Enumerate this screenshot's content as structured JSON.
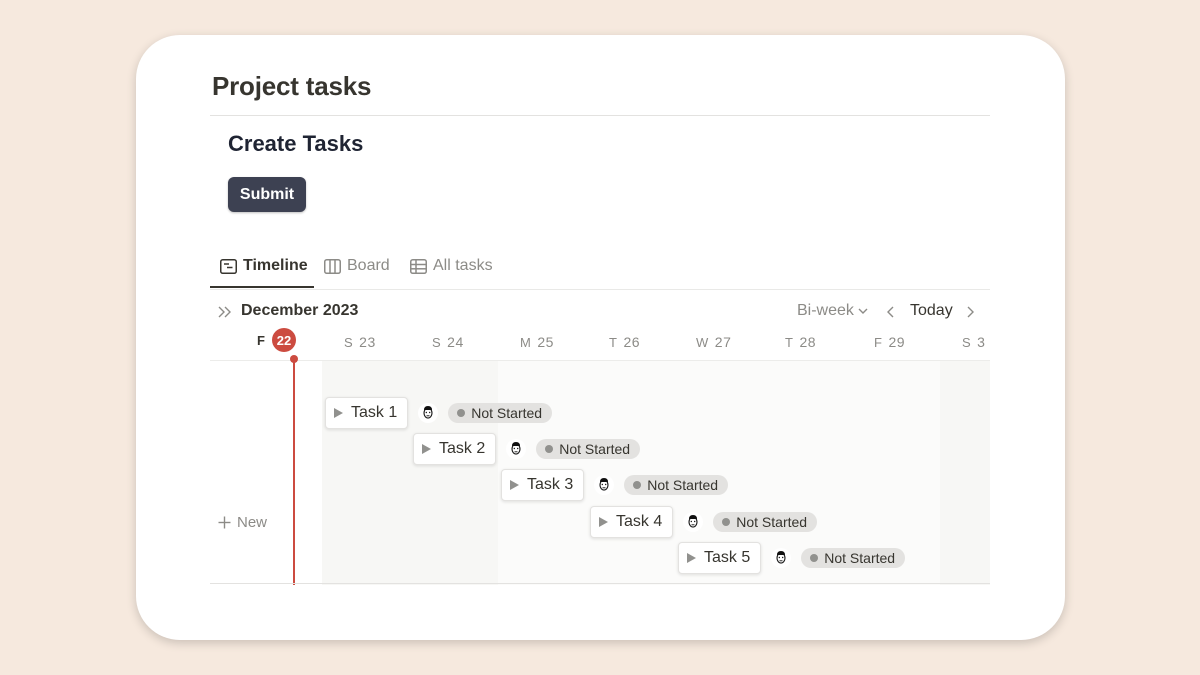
{
  "page": {
    "title": "Project tasks"
  },
  "form": {
    "title": "Create Tasks",
    "submit_label": "Submit"
  },
  "tabs": [
    {
      "label": "Timeline",
      "icon": "timeline-icon",
      "active": true
    },
    {
      "label": "Board",
      "icon": "board-icon",
      "active": false
    },
    {
      "label": "All tasks",
      "icon": "table-icon",
      "active": false
    }
  ],
  "timeline": {
    "month": "December 2023",
    "range": "Bi-week",
    "today_label": "Today",
    "today": {
      "letter": "F",
      "num": "22"
    },
    "days": [
      {
        "letter": "S",
        "num": "23"
      },
      {
        "letter": "S",
        "num": "24"
      },
      {
        "letter": "M",
        "num": "25"
      },
      {
        "letter": "T",
        "num": "26"
      },
      {
        "letter": "W",
        "num": "27"
      },
      {
        "letter": "T",
        "num": "28"
      },
      {
        "letter": "F",
        "num": "29"
      },
      {
        "letter": "S",
        "num": "3"
      }
    ],
    "new_label": "New"
  },
  "tasks": [
    {
      "name": "Task 1",
      "status": "Not Started"
    },
    {
      "name": "Task 2",
      "status": "Not Started"
    },
    {
      "name": "Task 3",
      "status": "Not Started"
    },
    {
      "name": "Task 4",
      "status": "Not Started"
    },
    {
      "name": "Task 5",
      "status": "Not Started"
    }
  ],
  "colors": {
    "background": "#f6e9de",
    "today_accent": "#cc4b40",
    "submit_button": "#3d4152",
    "status_badge": "#e3e2e0"
  }
}
